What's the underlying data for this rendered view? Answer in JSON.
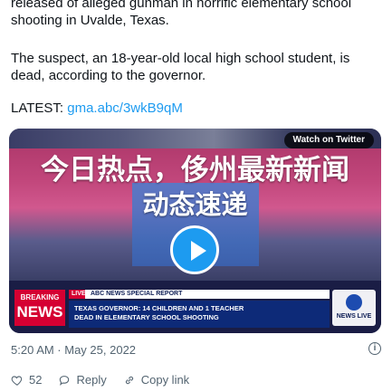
{
  "tweet": {
    "line1": "released of alleged gunman in horrific elementary school shooting in Uvalde, Texas.",
    "line2": "The suspect, an 18-year-old local high school student, is dead, according to the governor.",
    "latest_prefix": "LATEST: ",
    "latest_link": "gma.abc/3wkB9qM"
  },
  "media": {
    "watch_label": "Watch on Twitter",
    "overlay_line1": "今日热点，侈州最新新闻",
    "overlay_line2": "动态速递",
    "breaking_label": "BREAKING",
    "news_label": "NEWS",
    "live_label": "LIVE",
    "special_report": "ABC NEWS SPECIAL REPORT",
    "headline_line1": "TEXAS GOVERNOR: 14 CHILDREN AND 1 TEACHER",
    "headline_line2": "DEAD IN ELEMENTARY SCHOOL SHOOTING",
    "network_label": "NEWS LIVE"
  },
  "meta": {
    "timestamp": "5:20 AM · May 25, 2022"
  },
  "actions": {
    "likes": "52",
    "reply_label": "Reply",
    "copy_label": "Copy link"
  },
  "colors": {
    "link": "#1d9bf0",
    "breaking": "#d50032",
    "play_button": "#1d9bf0"
  }
}
